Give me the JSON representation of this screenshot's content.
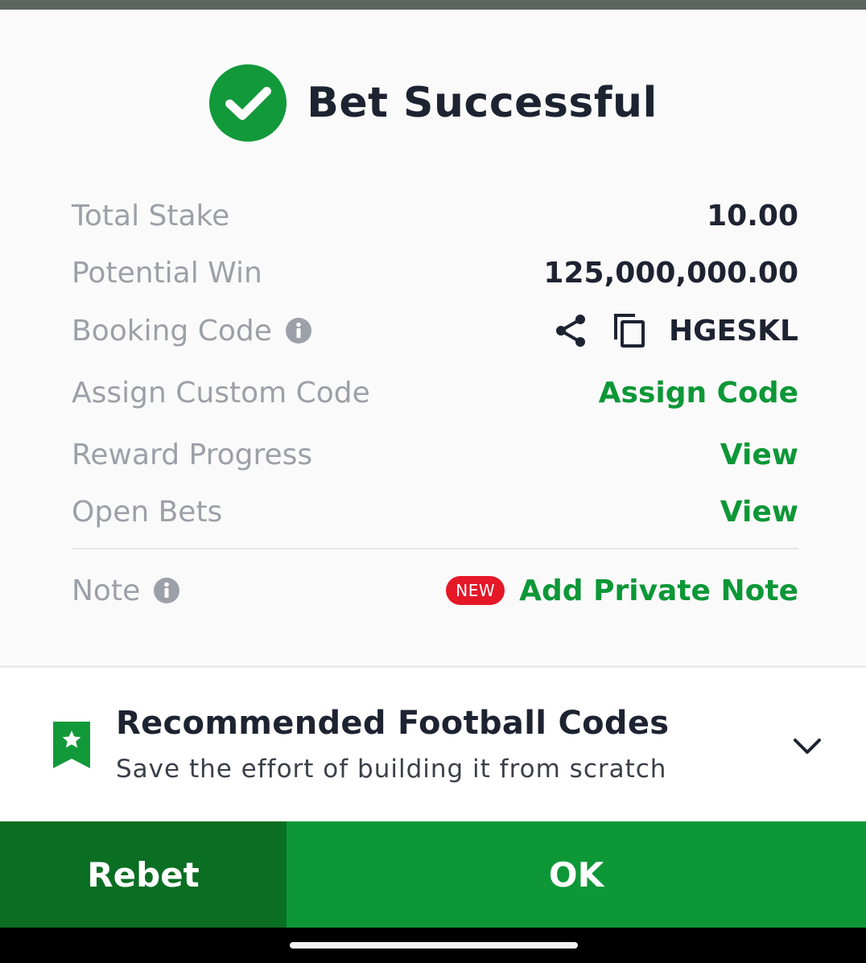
{
  "colors": {
    "accent_green": "#0d9737",
    "dark_green": "#0a6e23",
    "badge_red": "#e41827",
    "title_text": "#1d2331",
    "label_text": "#9ca0a8"
  },
  "header": {
    "icon": "check-circle-icon",
    "title": "Bet Successful"
  },
  "details": {
    "total_stake_label": "Total Stake",
    "total_stake_value": "10.00",
    "potential_win_label": "Potential Win",
    "potential_win_value": "125,000,000.00",
    "booking_code_label": "Booking Code",
    "booking_code_value": "HGESKL",
    "assign_custom_code_label": "Assign Custom Code",
    "assign_custom_code_action": "Assign Code",
    "reward_progress_label": "Reward Progress",
    "reward_progress_action": "View",
    "open_bets_label": "Open Bets",
    "open_bets_action": "View",
    "note_label": "Note",
    "note_badge": "NEW",
    "note_action": "Add Private Note"
  },
  "recommended": {
    "icon": "bookmark-star-icon",
    "title": "Recommended Football Codes",
    "subtitle": "Save the effort of building it from scratch"
  },
  "buttons": {
    "rebet": "Rebet",
    "ok": "OK"
  }
}
